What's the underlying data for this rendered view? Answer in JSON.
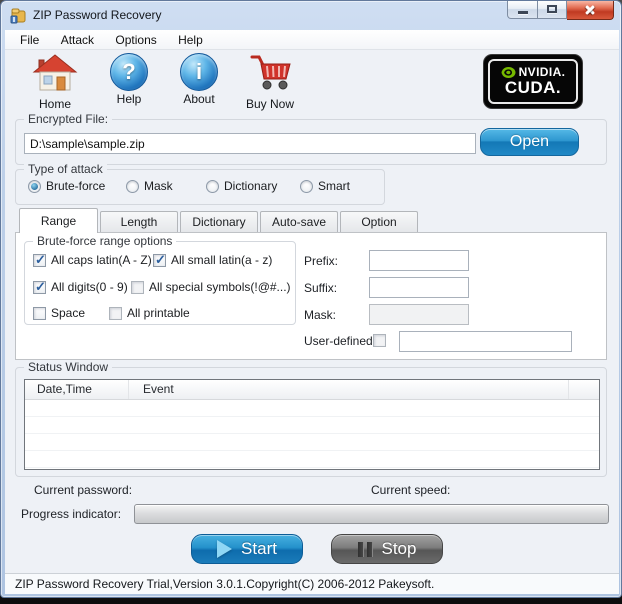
{
  "window": {
    "title": "ZIP Password Recovery"
  },
  "menu": {
    "items": [
      "File",
      "Attack",
      "Options",
      "Help"
    ]
  },
  "toolbar": {
    "buttons": [
      {
        "label": "Home",
        "icon": "home-icon"
      },
      {
        "label": "Help",
        "icon": "help-icon"
      },
      {
        "label": "About",
        "icon": "about-icon"
      },
      {
        "label": "Buy Now",
        "icon": "shopping-cart-icon"
      }
    ],
    "nvidia": {
      "brand": "NVIDIA.",
      "product": "CUDA."
    }
  },
  "file": {
    "group_label": "Encrypted File:",
    "path": "D:\\sample\\sample.zip",
    "open_label": "Open"
  },
  "attack": {
    "group_label": "Type of attack",
    "options": [
      {
        "label": "Brute-force",
        "selected": true
      },
      {
        "label": "Mask",
        "selected": false
      },
      {
        "label": "Dictionary",
        "selected": false
      },
      {
        "label": "Smart",
        "selected": false
      }
    ]
  },
  "tabs": {
    "items": [
      {
        "label": "Range",
        "active": true
      },
      {
        "label": "Length",
        "active": false
      },
      {
        "label": "Dictionary",
        "active": false
      },
      {
        "label": "Auto-save",
        "active": false
      },
      {
        "label": "Option",
        "active": false
      }
    ]
  },
  "range": {
    "group_label": "Brute-force range options",
    "checkboxes": [
      {
        "label": "All caps latin(A - Z)",
        "checked": true
      },
      {
        "label": "All small latin(a - z)",
        "checked": true
      },
      {
        "label": "All digits(0 - 9)",
        "checked": true
      },
      {
        "label": "All special symbols(!@#...)",
        "checked": false
      },
      {
        "label": "Space",
        "checked": false
      },
      {
        "label": "All printable",
        "checked": false
      }
    ],
    "fields": [
      {
        "label": "Prefix:",
        "value": "",
        "disabled": false
      },
      {
        "label": "Suffix:",
        "value": "",
        "disabled": false
      },
      {
        "label": "Mask:",
        "value": "",
        "disabled": true
      }
    ],
    "user_defined": {
      "label": "User-defined",
      "checked": false,
      "value": "",
      "disabled": true
    }
  },
  "status_window": {
    "group_label": "Status Window",
    "columns": [
      "Date,Time",
      "Event"
    ],
    "rows": []
  },
  "footer": {
    "current_password_label": "Current password:",
    "current_speed_label": "Current speed:",
    "progress_label": "Progress indicator:"
  },
  "actions": {
    "start_label": "Start",
    "stop_label": "Stop"
  },
  "statusbar": {
    "text": "ZIP Password Recovery Trial,Version 3.0.1.Copyright(C) 2006-2012 Pakeysoft."
  },
  "colors": {
    "accent_blue": "#1778b8",
    "nvidia_green": "#76b900",
    "close_red": "#c03a22",
    "client_bg": "#eef1f6"
  }
}
